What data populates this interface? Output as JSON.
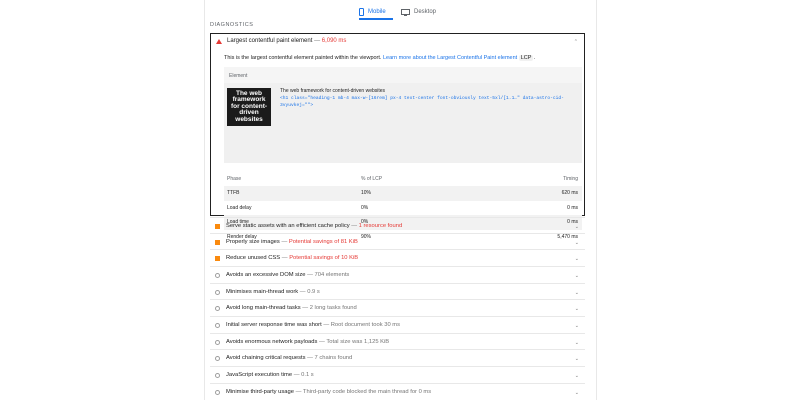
{
  "tabs": [
    {
      "label": "Mobile",
      "icon": "phone-icon",
      "active": true
    },
    {
      "label": "Desktop",
      "icon": "monitor-icon",
      "active": false
    }
  ],
  "section_title": "DIAGNOSTICS",
  "lcp": {
    "title": "Largest contentful paint element",
    "separator": "—",
    "value": "6,090 ms",
    "description_before": "This is the largest contentful element painted within the viewport.",
    "learn_more": "Learn more about the Largest Contentful Paint element",
    "chip": "LCP",
    "description_after": ".",
    "element_header": "Element",
    "thumb_text": "The web framework for content-driven websites",
    "node_label": "The web framework for content-driven websites",
    "node_snippet": "<h1 class=\"heading-1 mb-4 max-w-[16rem] px-4 text-center font-obviously text-5xl/[1.1…\" data-astro-cid-3vyuvkej=\"\">",
    "phase_headers": [
      "Phase",
      "% of LCP",
      "Timing"
    ],
    "phases": [
      {
        "phase": "TTFB",
        "pct": "10%",
        "timing": "620 ms"
      },
      {
        "phase": "Load delay",
        "pct": "0%",
        "timing": "0 ms"
      },
      {
        "phase": "Load time",
        "pct": "0%",
        "timing": "0 ms"
      },
      {
        "phase": "Render delay",
        "pct": "90%",
        "timing": "5,470 ms"
      }
    ]
  },
  "audits": [
    {
      "title": "Serve static assets with an efficient cache policy",
      "detail": "1 resource found",
      "severity": "orange",
      "detail_color": "red"
    },
    {
      "title": "Properly size images",
      "detail": "Potential savings of 81 KiB",
      "severity": "orange",
      "detail_color": "red"
    },
    {
      "title": "Reduce unused CSS",
      "detail": "Potential savings of 10 KiB",
      "severity": "orange",
      "detail_color": "red"
    },
    {
      "title": "Avoids an excessive DOM size",
      "detail": "704 elements",
      "severity": "info",
      "detail_color": "grey"
    },
    {
      "title": "Minimises main-thread work",
      "detail": "0.9 s",
      "severity": "info",
      "detail_color": "grey"
    },
    {
      "title": "Avoid long main-thread tasks",
      "detail": "2 long tasks found",
      "severity": "info",
      "detail_color": "grey"
    },
    {
      "title": "Initial server response time was short",
      "detail": "Root document took 30 ms",
      "severity": "info",
      "detail_color": "grey"
    },
    {
      "title": "Avoids enormous network payloads",
      "detail": "Total size was 1,125 KiB",
      "severity": "info",
      "detail_color": "grey"
    },
    {
      "title": "Avoid chaining critical requests",
      "detail": "7 chains found",
      "severity": "info",
      "detail_color": "grey"
    },
    {
      "title": "JavaScript execution time",
      "detail": "0.1 s",
      "severity": "info",
      "detail_color": "grey"
    },
    {
      "title": "Minimise third-party usage",
      "detail": "Third-party code blocked the main thread for 0 ms",
      "severity": "info",
      "detail_color": "grey"
    }
  ],
  "separator": "—",
  "colors": {
    "accent": "#1a73e8",
    "fail": "#e53935",
    "warn": "#fa8a0e"
  }
}
